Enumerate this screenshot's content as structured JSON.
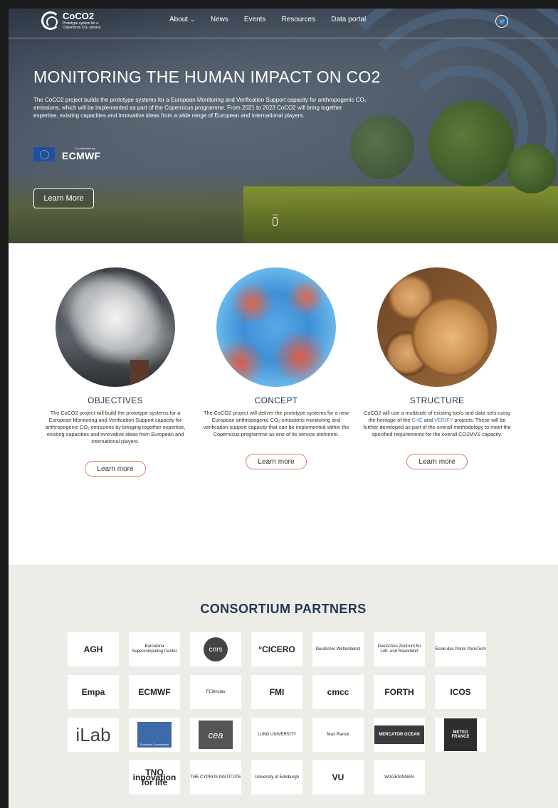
{
  "header": {
    "logo_name": "CoCO2",
    "logo_sub": "Prototype system for a Copernicus CO₂ service",
    "nav": [
      {
        "label": "About",
        "has_dropdown": true
      },
      {
        "label": "News"
      },
      {
        "label": "Events"
      },
      {
        "label": "Resources"
      },
      {
        "label": "Data portal"
      }
    ],
    "social_icon": "twitter-icon"
  },
  "hero": {
    "title": "MONITORING THE HUMAN IMPACT ON CO2",
    "text": "The CoCO2 project builds the prototype systems for a European Monitoring and Verification Support capacity for anthropogenic CO₂ emissions, which will be implemented as part of the Copernicus programme. From 2021 to 2023 CoCO2 will bring together expertise, existing capacities and innovative ideas from a wide range of European and international players.",
    "coordinated_by": "Co-ordinated by",
    "ecmwf": "ECMWF",
    "button": "Learn More",
    "scroll_label": "Scroll"
  },
  "features": [
    {
      "title": "OBJECTIVES",
      "desc": "The CoCO2 project will build the prototype systems for a European Monitoring and Verification Support capacity for anthropogenic CO₂ emissions by bringing together expertise, existing capacities and innovative ideas from European and international players.",
      "button": "Learn more"
    },
    {
      "title": "CONCEPT",
      "desc": "The CoCO2 project will deliver the prototype systems for a new European anthropogenic CO₂ emissions monitoring and verification support capacity that can be implemented within the Copernicus programme as one of its service elements.",
      "button": "Learn more"
    },
    {
      "title": "STRUCTURE",
      "desc_before": "CoCO2 will use a multitude of existing tools and data sets using the heritage of the ",
      "link1": "CHE",
      "desc_mid": " and ",
      "link2": "VERIFY",
      "desc_after": " projects. These will be further developed as part of the overall methodology to meet the specified requirements for the overall CO2MVS capacity.",
      "button": "Learn more"
    }
  ],
  "partners": {
    "title": "CONSORTIUM PARTNERS",
    "logos": [
      "AGH",
      "Barcelona Supercomputing Center",
      "cnrs",
      "°CICERO",
      "Deutscher Wetterdienst",
      "Deutsches Zentrum für Luft- und Raumfahrt",
      "École des Ponts ParisTech",
      "Empa",
      "ECMWF",
      "FCiências",
      "FMI",
      "cmcc",
      "FORTH",
      "ICOS",
      "iLab",
      "European Commission",
      "cea",
      "LUND UNIVERSITY",
      "Max Planck",
      "MERCATOR OCEAN",
      "METEO FRANCE",
      "TNO innovation for life",
      "THE CYPRUS INSTITUTE",
      "University of Edinburgh",
      "VU",
      "WAGENINGEN"
    ]
  }
}
